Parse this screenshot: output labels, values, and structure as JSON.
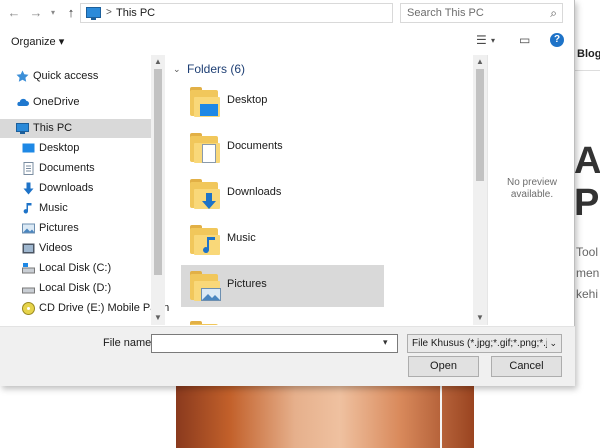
{
  "window": {
    "address": {
      "crumb": "This PC",
      "separator": ">"
    },
    "search": {
      "placeholder": "Search This PC"
    },
    "toolbar": {
      "organize_label": "Organize ▾"
    }
  },
  "sidebar": {
    "items": [
      {
        "label": "Quick access",
        "icon": "star-icon"
      },
      {
        "label": "OneDrive",
        "icon": "cloud-icon"
      },
      {
        "label": "This PC",
        "icon": "computer-icon",
        "selected": true
      },
      {
        "label": "Desktop",
        "icon": "desktop-icon"
      },
      {
        "label": "Documents",
        "icon": "documents-icon"
      },
      {
        "label": "Downloads",
        "icon": "download-icon"
      },
      {
        "label": "Music",
        "icon": "music-icon"
      },
      {
        "label": "Pictures",
        "icon": "pictures-icon"
      },
      {
        "label": "Videos",
        "icon": "videos-icon"
      },
      {
        "label": "Local Disk (C:)",
        "icon": "drive-icon"
      },
      {
        "label": "Local Disk (D:)",
        "icon": "drive-icon"
      },
      {
        "label": "CD Drive (E:) Mobile Partn",
        "icon": "cd-drive-icon"
      }
    ]
  },
  "main": {
    "group_header": "Folders (6)",
    "folders": [
      {
        "name": "Desktop",
        "overlay": "desktop"
      },
      {
        "name": "Documents",
        "overlay": "document"
      },
      {
        "name": "Downloads",
        "overlay": "download"
      },
      {
        "name": "Music",
        "overlay": "music"
      },
      {
        "name": "Pictures",
        "overlay": "picture",
        "selected": true
      }
    ]
  },
  "preview": {
    "line1": "No preview",
    "line2": "available."
  },
  "footer": {
    "filename_label": "File name:",
    "filename_value": "",
    "filter_label": "File Khusus (*.jpg;*.gif;*.png;*.jp",
    "open_label": "Open",
    "cancel_label": "Cancel"
  },
  "background_page": {
    "nav_text": "Blog",
    "heading_1": "A",
    "heading_2": "P",
    "text_1": "Tool",
    "text_2": "men",
    "text_3": "kehi"
  },
  "colors": {
    "accent": "#1e73c8",
    "folder": "#f1c75b",
    "selected": "#d9d9d9"
  }
}
